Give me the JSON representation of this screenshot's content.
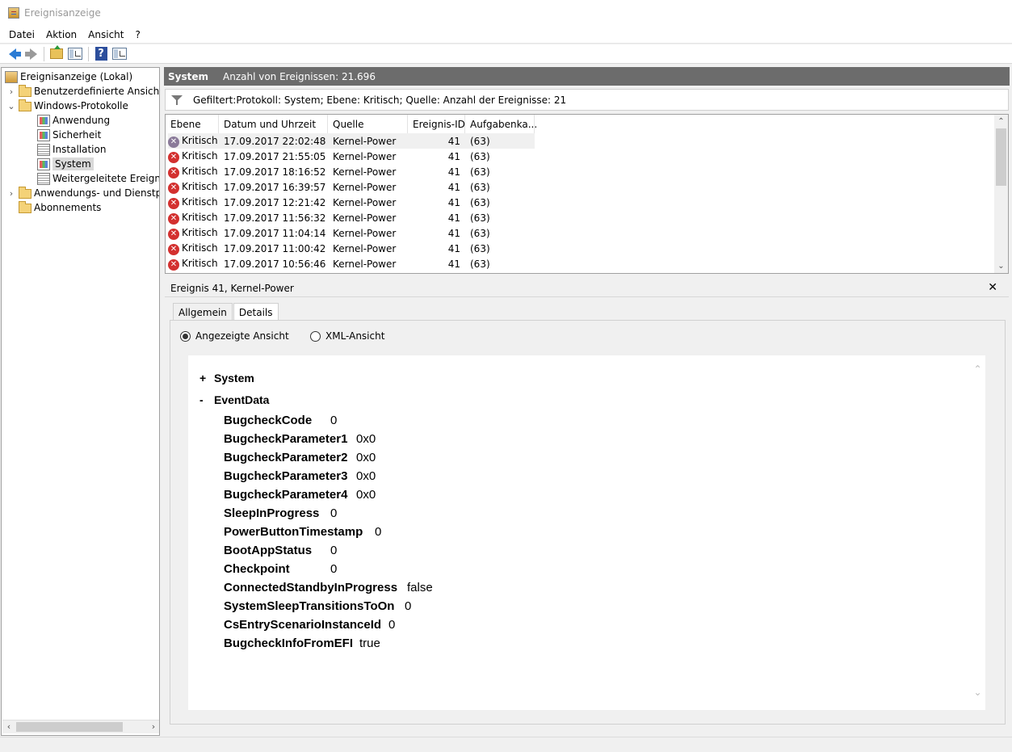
{
  "window": {
    "title": "Ereignisanzeige"
  },
  "menu": [
    "Datei",
    "Aktion",
    "Ansicht",
    "?"
  ],
  "toolbar": {
    "icons": [
      "back-arrow-icon",
      "forward-arrow-icon",
      "up-folder-icon",
      "show-hide-tree-icon",
      "help-icon",
      "show-hide-action-icon"
    ]
  },
  "tree": {
    "root": "Ereignisanzeige (Lokal)",
    "custom_views": "Benutzerdefinierte Ansichten",
    "windows_logs": "Windows-Protokolle",
    "app": "Anwendung",
    "security": "Sicherheit",
    "setup": "Installation",
    "system": "System",
    "forwarded": "Weitergeleitete Ereignisse",
    "app_services": "Anwendungs- und Dienstprotokolle",
    "subscriptions": "Abonnements"
  },
  "header": {
    "title": "System",
    "count": "Anzahl von Ereignissen: 21.696"
  },
  "filter": {
    "text": "Gefiltert:Protokoll: System; Ebene: Kritisch; Quelle:  Anzahl der Ereignisse: 21"
  },
  "grid": {
    "columns": [
      "Ebene",
      "Datum und Uhrzeit",
      "Quelle",
      "Ereignis-ID",
      "Aufgabenka..."
    ],
    "rows": [
      [
        "Kritisch",
        "17.09.2017 22:02:48",
        "Kernel-Power",
        "41",
        "(63)"
      ],
      [
        "Kritisch",
        "17.09.2017 21:55:05",
        "Kernel-Power",
        "41",
        "(63)"
      ],
      [
        "Kritisch",
        "17.09.2017 18:16:52",
        "Kernel-Power",
        "41",
        "(63)"
      ],
      [
        "Kritisch",
        "17.09.2017 16:39:57",
        "Kernel-Power",
        "41",
        "(63)"
      ],
      [
        "Kritisch",
        "17.09.2017 12:21:42",
        "Kernel-Power",
        "41",
        "(63)"
      ],
      [
        "Kritisch",
        "17.09.2017 11:56:32",
        "Kernel-Power",
        "41",
        "(63)"
      ],
      [
        "Kritisch",
        "17.09.2017 11:04:14",
        "Kernel-Power",
        "41",
        "(63)"
      ],
      [
        "Kritisch",
        "17.09.2017 11:00:42",
        "Kernel-Power",
        "41",
        "(63)"
      ],
      [
        "Kritisch",
        "17.09.2017 10:56:46",
        "Kernel-Power",
        "41",
        "(63)"
      ]
    ]
  },
  "detail": {
    "title": "Ereignis 41, Kernel-Power",
    "tabs": [
      "Allgemein",
      "Details"
    ],
    "radio_friendly": "Angezeigte Ansicht",
    "radio_xml": "XML-Ansicht",
    "section_system": "System",
    "section_eventdata": "EventData",
    "sign_plus": "+",
    "sign_minus": "-",
    "fields": [
      [
        "BugcheckCode",
        "0"
      ],
      [
        "BugcheckParameter1",
        "0x0"
      ],
      [
        "BugcheckParameter2",
        "0x0"
      ],
      [
        "BugcheckParameter3",
        "0x0"
      ],
      [
        "BugcheckParameter4",
        "0x0"
      ],
      [
        "SleepInProgress",
        "0"
      ],
      [
        "PowerButtonTimestamp",
        "0"
      ],
      [
        "BootAppStatus",
        "0"
      ],
      [
        "Checkpoint",
        "0"
      ],
      [
        "ConnectedStandbyInProgress",
        "false"
      ],
      [
        "SystemSleepTransitionsToOn",
        "0"
      ],
      [
        "CsEntryScenarioInstanceId",
        "0"
      ],
      [
        "BugcheckInfoFromEFI",
        "true"
      ]
    ]
  },
  "colors": {
    "header_bg": "#6c6c6c",
    "error_icon": "#d3302f",
    "selection": "#d9d9d9"
  }
}
